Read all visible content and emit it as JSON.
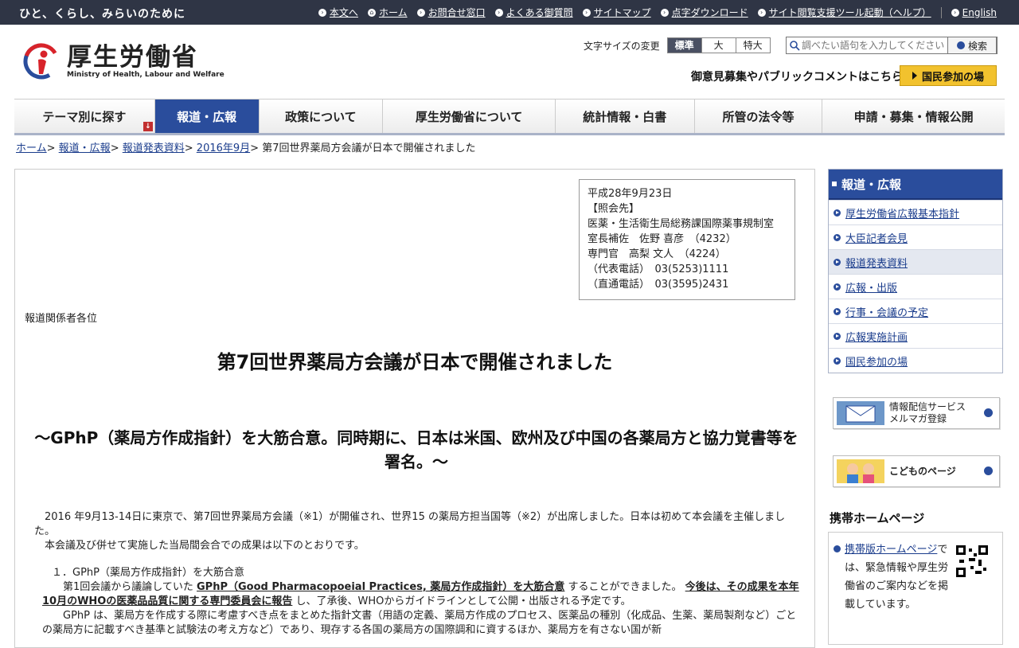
{
  "topbar": {
    "tagline": "ひと、くらし、みらいのために",
    "links": [
      {
        "label": "本文へ",
        "icon": "arrow-circle-icon"
      },
      {
        "label": "ホーム",
        "icon": "home-icon"
      },
      {
        "label": "お問合せ窓口",
        "icon": "arrow-circle-icon"
      },
      {
        "label": "よくある御質問",
        "icon": "arrow-circle-icon"
      },
      {
        "label": "サイトマップ",
        "icon": "arrow-circle-icon"
      },
      {
        "label": "点字ダウンロード",
        "icon": "arrow-circle-icon"
      },
      {
        "label": "サイト閲覧支援ツール起動（ヘルプ）",
        "icon": "arrow-circle-icon"
      },
      {
        "label": "English",
        "icon": "arrow-circle-icon"
      }
    ]
  },
  "header": {
    "logo_ja": "厚生労働省",
    "logo_en": "Ministry of Health, Labour and Welfare",
    "fontsize_label": "文字サイズの変更",
    "fontsize_options": [
      "標準",
      "大",
      "特大"
    ],
    "fontsize_selected": "標準",
    "search_placeholder": "調べたい語句を入力してください",
    "search_button": "検索",
    "pubcomment": "御意見募集やパブリックコメントはこちら",
    "kokumin": "国民参加の場"
  },
  "nav": [
    "テーマ別に探す",
    "報道・広報",
    "政策について",
    "厚生労働省について",
    "統計情報・白書",
    "所管の法令等",
    "申請・募集・情報公開"
  ],
  "nav_active": "報道・広報",
  "breadcrumb": {
    "links": [
      "ホーム",
      "報道・広報",
      "報道発表資料",
      "2016年9月"
    ],
    "current": "第7回世界薬局方会議が日本で開催されました",
    "sep": ">"
  },
  "contact": {
    "lines": [
      "平成28年9月23日",
      "【照会先】",
      "医薬・生活衛生局総務課国際薬事規制室",
      "室長補佐　佐野 喜彦　（4232）",
      "専門官　高梨 文人　（4224）",
      "（代表電話）　03(5253)1111",
      "（直通電話）　03(3595)2431"
    ]
  },
  "article": {
    "recipient": "報道関係者各位",
    "title": "第7回世界薬局方会議が日本で開催されました",
    "subtitle": "～GPhP（薬局方作成指針）を大筋合意。同時期に、日本は米国、欧州及び中国の各薬局方と協力覚書等を署名。～",
    "para1": "2016 年9月13-14日に東京で、第7回世界薬局方会議（※1）が開催され、世界15 の薬局方担当国等（※2）が出席しました。日本は初めて本会議を主催しました。",
    "para2": "本会議及び併せて実施した当局間会合での成果は以下のとおりです。",
    "sec1_head": "１．GPhP（薬局方作成指針）を大筋合意",
    "sec1_a": "第1回会議から議論していた ",
    "sec1_b": "GPhP（Good Pharmacopoeial Practices, 薬局方作成指針）を大筋合意",
    "sec1_c": " することができました。 ",
    "sec1_d": "今後は、その成果を本年10月のWHOの医薬品品質に関する専門委員会に報告",
    "sec1_e": " し、了承後、WHOからガイドラインとして公開・出版される予定です。",
    "sec1_f": "GPhP は、薬局方を作成する際に考慮すべき点をまとめた指針文書（用語の定義、薬局方作成のプロセス、医薬品の種別（化成品、生薬、薬局製剤など）ごとの薬局方に記載すべき基準と試験法の考え方など）であり、現存する各国の薬局方の国際調和に資するほか、薬局方を有さない国が新"
  },
  "sidebar": {
    "head": "報道・広報",
    "items": [
      "厚生労働省広報基本指針",
      "大臣記者会見",
      "報道発表資料",
      "広報・出版",
      "行事・会議の予定",
      "広報実施計画",
      "国民参加の場"
    ],
    "active": "報道発表資料",
    "banner1": [
      "情報配信サービス",
      "メルマガ登録"
    ],
    "banner2": "こどものページ",
    "mobile_title": "携帯ホームページ",
    "mobile_link": "携帯版ホームページ",
    "mobile_text": "では、緊急情報や厚生労働省のご案内などを掲載しています。"
  },
  "colors": {
    "brand_blue": "#2a4d9c",
    "topbar": "#2f3545",
    "accent_yellow": "#f2c22e",
    "logo_red": "#d8232a"
  }
}
